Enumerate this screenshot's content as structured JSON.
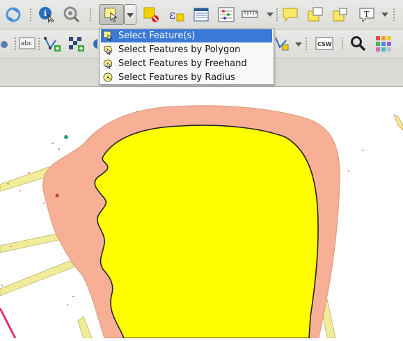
{
  "toolbar_top": {
    "icons": [
      "refresh-icon",
      "identify-icon",
      "zoom-settings-icon",
      "select-feature-icon",
      "deselect-icon",
      "expression-select-icon",
      "attribute-table-icon",
      "statistics-icon",
      "measure-icon",
      "annotation-icon",
      "text-annotation-icon"
    ]
  },
  "select_menu": {
    "items": [
      {
        "label": "Select Feature(s)",
        "icon": "select-rectangle-icon",
        "selected": true
      },
      {
        "label": "Select Features by Polygon",
        "icon": "select-polygon-icon",
        "selected": false
      },
      {
        "label": "Select Features by Freehand",
        "icon": "select-freehand-icon",
        "selected": false
      },
      {
        "label": "Select Features by Radius",
        "icon": "select-radius-icon",
        "selected": false
      }
    ]
  },
  "toolbar_second": {
    "csw_label": "CSW",
    "abc_label": "abc"
  },
  "colors": {
    "selected_polygon_fill": "#ffff00",
    "region_fill": "#f7b095",
    "path_fill": "#f1ec9a",
    "menu_highlight": "#3a7ad6"
  }
}
